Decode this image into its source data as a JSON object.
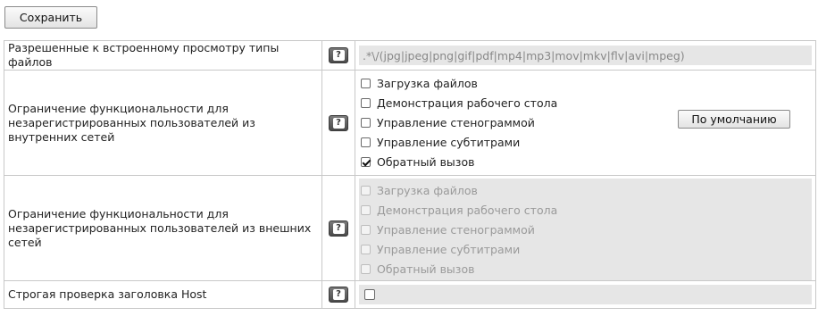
{
  "toolbar": {
    "save_label": "Сохранить"
  },
  "rows": {
    "file_types": {
      "label": "Разрешенные к встроенному просмотру типы файлов",
      "value": ".*\\/(jpg|jpeg|png|gif|pdf|mp4|mp3|mov|mkv|flv|avi|mpeg)"
    },
    "internal": {
      "label": "Ограничение функциональности для незарегистрированных пользователей из внутренних сетей",
      "default_button": "По умолчанию",
      "options": [
        {
          "label": "Загрузка файлов",
          "checked": false
        },
        {
          "label": "Демонстрация рабочего стола",
          "checked": false
        },
        {
          "label": "Управление стенограммой",
          "checked": false
        },
        {
          "label": "Управление субтитрами",
          "checked": false
        },
        {
          "label": "Обратный вызов",
          "checked": true
        }
      ]
    },
    "external": {
      "label": "Ограничение функциональности для незарегистрированных пользователей из внешних сетей",
      "options": [
        {
          "label": "Загрузка файлов",
          "checked": false
        },
        {
          "label": "Демонстрация рабочего стола",
          "checked": false
        },
        {
          "label": "Управление стенограммой",
          "checked": false
        },
        {
          "label": "Управление субтитрами",
          "checked": false
        },
        {
          "label": "Обратный вызов",
          "checked": false
        }
      ]
    },
    "host_check": {
      "label": "Строгая проверка заголовка Host",
      "checked": false
    }
  },
  "icons": {
    "help": "help-icon",
    "help_glyph": "?"
  }
}
